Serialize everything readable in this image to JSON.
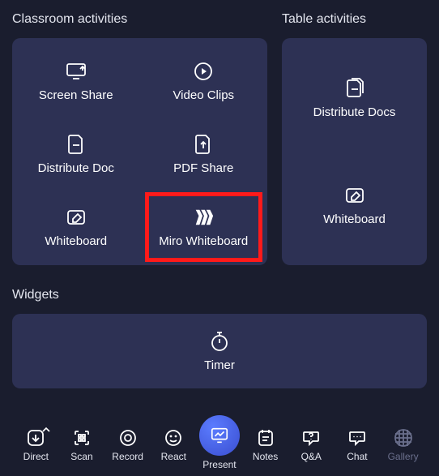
{
  "sections": {
    "classroom": {
      "title": "Classroom activities",
      "tiles": [
        {
          "label": "Screen Share"
        },
        {
          "label": "Video Clips"
        },
        {
          "label": "Distribute Doc"
        },
        {
          "label": "PDF Share"
        },
        {
          "label": "Whiteboard"
        },
        {
          "label": "Miro Whiteboard"
        }
      ]
    },
    "table": {
      "title": "Table activities",
      "tiles": [
        {
          "label": "Distribute Docs"
        },
        {
          "label": "Whiteboard"
        }
      ]
    },
    "widgets": {
      "title": "Widgets",
      "tiles": [
        {
          "label": "Timer"
        }
      ]
    }
  },
  "bottomBar": [
    {
      "label": "Direct"
    },
    {
      "label": "Scan"
    },
    {
      "label": "Record"
    },
    {
      "label": "React"
    },
    {
      "label": "Present"
    },
    {
      "label": "Notes"
    },
    {
      "label": "Q&A"
    },
    {
      "label": "Chat"
    },
    {
      "label": "Gallery"
    }
  ]
}
